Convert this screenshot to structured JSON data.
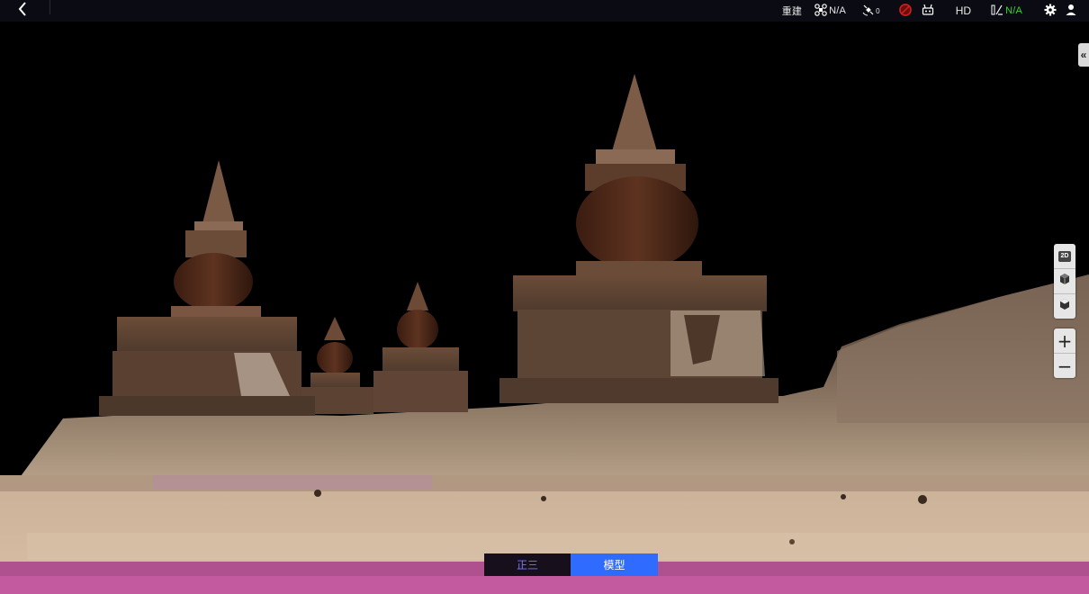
{
  "topbar": {
    "mode_label": "重建",
    "aircraft_value": "N/A",
    "gps_value": "0",
    "video_quality": "HD",
    "signal_value": "N/A"
  },
  "icons": {
    "back": "chevron-left-icon",
    "aircraft": "drone-icon",
    "gps": "satellite-icon",
    "rc_disconnected": "no-remote-icon",
    "rc": "remote-controller-icon",
    "signal": "signal-icon",
    "settings": "gear-icon",
    "user": "user-icon",
    "panel_toggle": "double-chevron-left-icon",
    "view_2d": "2d-view-icon",
    "view_3d_a": "cube-icon",
    "view_3d_b": "cube-outline-icon"
  },
  "side_toggle": {
    "label": "«"
  },
  "view_tools": {
    "label_2d": "2D"
  },
  "zoom": {
    "in_label": "+",
    "out_label": "−"
  },
  "mode_switch": {
    "tabs": [
      {
        "label": "正三",
        "active": false
      },
      {
        "label": "模型",
        "active": true
      }
    ]
  },
  "colors": {
    "accent": "#2f6bff",
    "topbar": "#0b0b14",
    "signal_ok": "#3dd13d",
    "alert": "#d02020"
  }
}
